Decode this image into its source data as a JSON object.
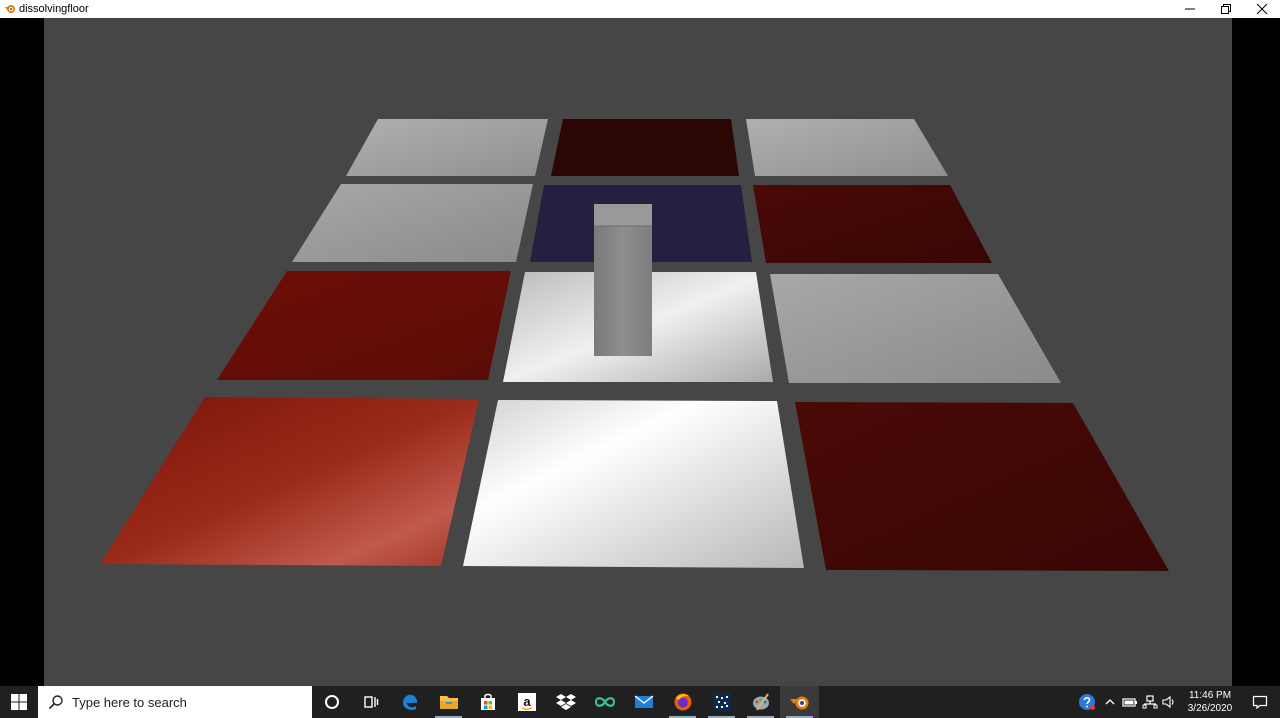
{
  "window": {
    "title": "dissolvingfloor",
    "controls": [
      "minimize-icon",
      "restore-icon",
      "close-icon"
    ]
  },
  "game": {
    "floor_tiles": [
      {
        "row": 1,
        "col": 1,
        "color": "white"
      },
      {
        "row": 1,
        "col": 2,
        "color": "dark-red"
      },
      {
        "row": 1,
        "col": 3,
        "color": "white"
      },
      {
        "row": 2,
        "col": 1,
        "color": "white"
      },
      {
        "row": 2,
        "col": 2,
        "color": "navy"
      },
      {
        "row": 2,
        "col": 3,
        "color": "dark-red"
      },
      {
        "row": 3,
        "col": 1,
        "color": "red"
      },
      {
        "row": 3,
        "col": 2,
        "color": "white"
      },
      {
        "row": 3,
        "col": 3,
        "color": "white"
      },
      {
        "row": 4,
        "col": 1,
        "color": "red"
      },
      {
        "row": 4,
        "col": 2,
        "color": "white"
      },
      {
        "row": 4,
        "col": 3,
        "color": "dark-red"
      }
    ],
    "player": "grey-box",
    "colors": {
      "background": "#464646",
      "red": "#8a1a10",
      "dark_red": "#3c0806",
      "navy": "#242040",
      "white": "#d8d8d8"
    }
  },
  "taskbar": {
    "search_placeholder": "Type here to search",
    "apps": [
      "cortana-icon",
      "task-view-icon",
      "edge-icon",
      "file-explorer-icon",
      "store-icon",
      "amazon-icon",
      "dropbox-icon",
      "infinity-icon",
      "mail-icon",
      "firefox-icon",
      "pixel-app-icon",
      "paint-icon",
      "blender-icon"
    ],
    "amazon_letter": "a",
    "tray": {
      "time": "11:46 PM",
      "date": "3/26/2020"
    }
  }
}
